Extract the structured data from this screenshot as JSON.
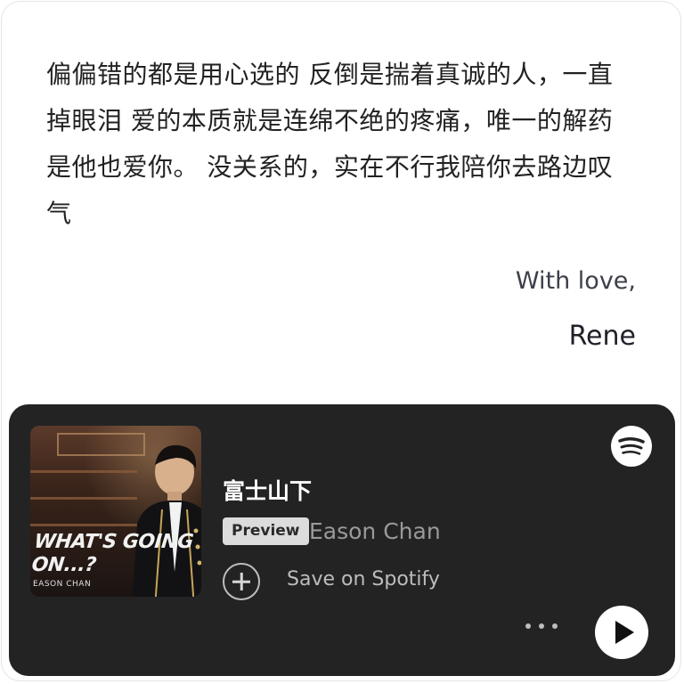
{
  "message": {
    "text": "偏偏错的都是用心选的 反倒是揣着真诚的人，一直掉眼泪 爱的本质就是连绵不绝的疼痛，唯一的解药是他也爱你。 没关系的，实在不行我陪你去路边叹气"
  },
  "signoff": {
    "closing": "With love,",
    "name": "Rene"
  },
  "player": {
    "cover": {
      "title": "WHAT'S GOING ON...?",
      "artist": "EASON CHAN"
    },
    "track_title": "富士山下",
    "preview_badge": "Preview",
    "artist": "Eason Chan",
    "save_label": "Save on Spotify",
    "icons": {
      "brand": "spotify-icon",
      "save": "plus-circle-icon",
      "more": "ellipsis-icon",
      "play": "play-icon"
    },
    "colors": {
      "background": "#232323",
      "badge": "#dcdcdc",
      "muted_text": "#9a9a9a"
    }
  }
}
